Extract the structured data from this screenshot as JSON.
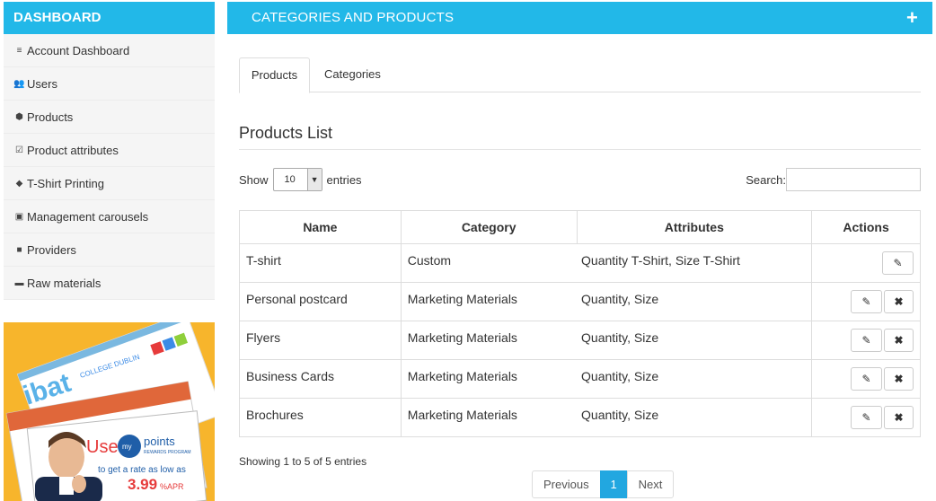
{
  "sidebar": {
    "title": "DASHBOARD",
    "items": [
      {
        "icon": "bars-icon",
        "glyph": "≡",
        "label": "Account Dashboard"
      },
      {
        "icon": "users-icon",
        "glyph": "👥",
        "label": "Users"
      },
      {
        "icon": "cubes-icon",
        "glyph": "⬢",
        "label": "Products"
      },
      {
        "icon": "check-square-icon",
        "glyph": "☑",
        "label": "Product attributes"
      },
      {
        "icon": "tag-icon",
        "glyph": "◆",
        "label": "T-Shirt Printing"
      },
      {
        "icon": "image-icon",
        "glyph": "▣",
        "label": "Management carousels"
      },
      {
        "icon": "truck-icon",
        "glyph": "■",
        "label": "Providers"
      },
      {
        "icon": "folder-open-icon",
        "glyph": "▬",
        "label": "Raw materials"
      }
    ]
  },
  "promo": {
    "brand": "ibat",
    "brand_sub": "COLLEGE DUBLIN",
    "use": "Use",
    "my": "my",
    "points": "points",
    "rewards": "REWARDS PROGRAM",
    "rate_text": "to get a rate as low as",
    "rate": "3.99",
    "rate_suffix": "%",
    "apr": "APR"
  },
  "panel": {
    "title": "CATEGORIES AND PRODUCTS",
    "add_glyph": "+"
  },
  "tabs": [
    "Products",
    "Categories"
  ],
  "list_title": "Products List",
  "show": {
    "prefix": "Show",
    "value": "10",
    "suffix": "entries"
  },
  "search": {
    "label": "Search:",
    "placeholder": ""
  },
  "table": {
    "columns": [
      "Name",
      "Category",
      "Attributes",
      "Actions"
    ],
    "rows": [
      {
        "name": "T-shirt",
        "category": "Custom",
        "attributes": "Quantity T-Shirt, Size T-Shirt"
      },
      {
        "name": "Personal postcard",
        "category": "Marketing Materials",
        "attributes": "Quantity, Size"
      },
      {
        "name": "Flyers",
        "category": "Marketing Materials",
        "attributes": "Quantity, Size"
      },
      {
        "name": "Business Cards",
        "category": "Marketing Materials",
        "attributes": "Quantity, Size"
      },
      {
        "name": "Brochures",
        "category": "Marketing Materials",
        "attributes": "Quantity, Size"
      }
    ],
    "edit_glyph": "✎",
    "delete_glyph": "✖"
  },
  "info": "Showing 1 to 5 of 5 entries",
  "pagination": {
    "previous": "Previous",
    "current": "1",
    "next": "Next"
  },
  "colors": {
    "accent": "#22b8e8",
    "promo_bg": "#f7b52c",
    "active_page": "#22a7e0"
  }
}
